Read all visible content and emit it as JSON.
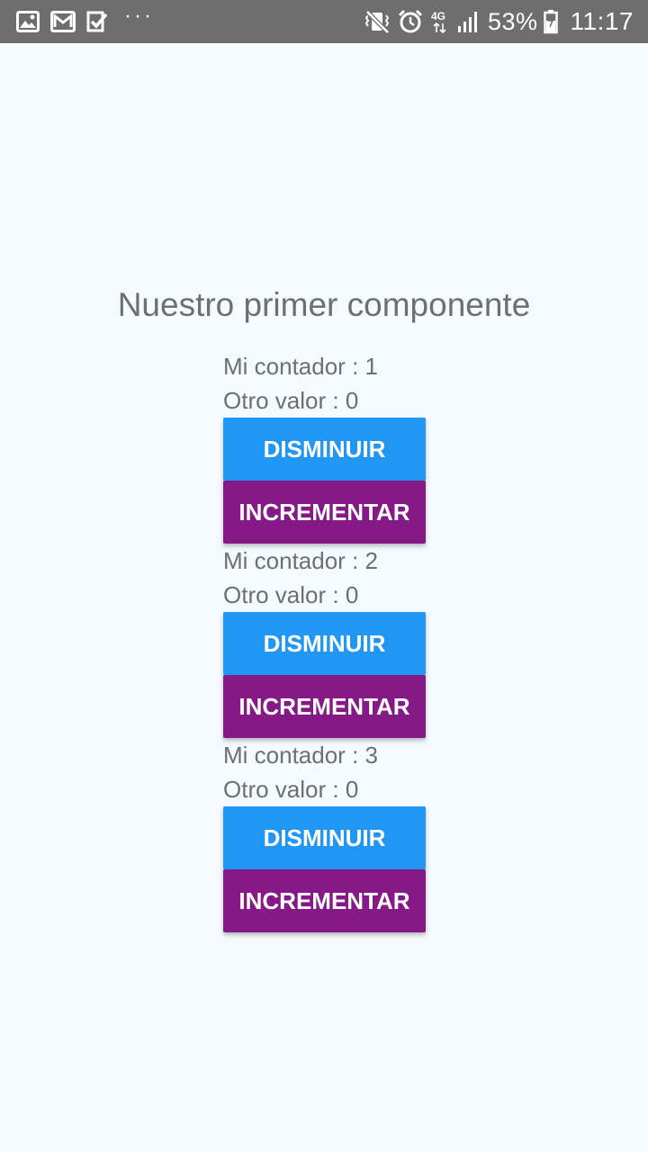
{
  "status_bar": {
    "battery_percent": "53%",
    "time": "11:17",
    "network": "4G",
    "icons": [
      "image-icon",
      "gmail-icon",
      "checklist-icon",
      "more-dots-icon",
      "vibrate-mute-icon",
      "alarm-icon",
      "network-4g-icon",
      "signal-icon",
      "battery-icon"
    ],
    "more_dots": "···"
  },
  "page": {
    "title": "Nuestro primer componente"
  },
  "counters": [
    {
      "contador_label": "Mi contador : 1",
      "otro_label": "Otro valor : 0",
      "decrement_label": "DISMINUIR",
      "increment_label": "INCREMENTAR"
    },
    {
      "contador_label": "Mi contador : 2",
      "otro_label": "Otro valor : 0",
      "decrement_label": "DISMINUIR",
      "increment_label": "INCREMENTAR"
    },
    {
      "contador_label": "Mi contador : 3",
      "otro_label": "Otro valor : 0",
      "decrement_label": "DISMINUIR",
      "increment_label": "INCREMENTAR"
    }
  ],
  "colors": {
    "background": "#f4faff",
    "status_bar": "#6e6e6e",
    "decrement_button": "#2196f3",
    "increment_button": "#851a86",
    "text": "#6d6f74"
  }
}
